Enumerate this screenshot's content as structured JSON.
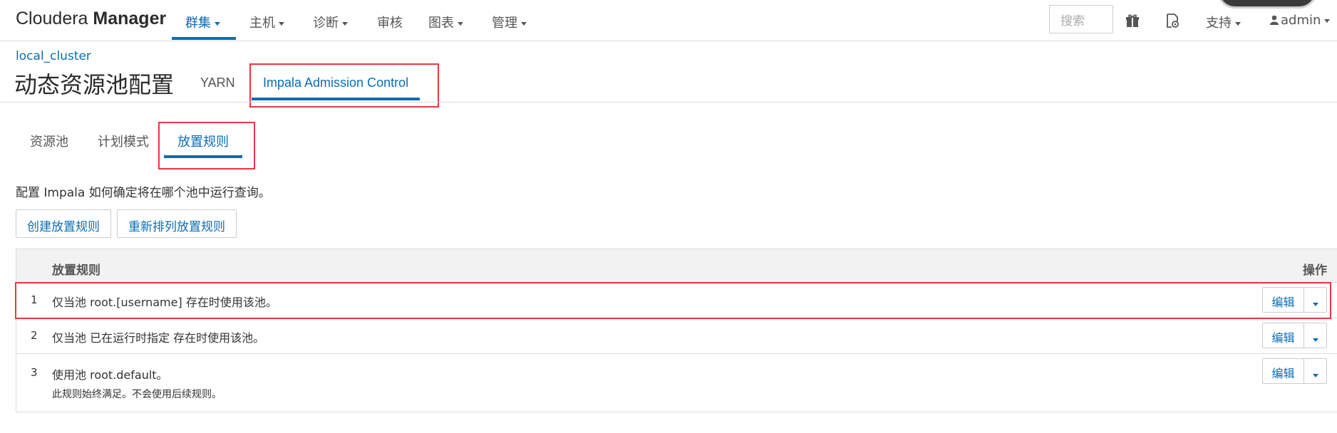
{
  "brand": {
    "part1": "Cloudera ",
    "part2": "Manager"
  },
  "nav": {
    "items": [
      {
        "label": "群集"
      },
      {
        "label": "主机"
      },
      {
        "label": "诊断"
      },
      {
        "label": "审核"
      },
      {
        "label": "图表"
      },
      {
        "label": "管理"
      }
    ],
    "active_index": 0,
    "search_placeholder": "搜索",
    "support_label": "支持",
    "user_label": "admin"
  },
  "breadcrumb": "local_cluster",
  "page_title": "动态资源池配置",
  "page_tabs": [
    {
      "label": "YARN"
    },
    {
      "label": "Impala Admission Control"
    }
  ],
  "sub_tabs": [
    {
      "label": "资源池"
    },
    {
      "label": "计划模式"
    },
    {
      "label": "放置规则"
    }
  ],
  "description": "配置 Impala 如何确定将在哪个池中运行查询。",
  "buttons": {
    "create": "创建放置规则",
    "reorder": "重新排列放置规则"
  },
  "table": {
    "col_rule": "放置规则",
    "col_ops": "操作",
    "rows": [
      {
        "num": "1",
        "text": "仅当池 root.[username] 存在时使用该池。",
        "note": "",
        "edit": "编辑"
      },
      {
        "num": "2",
        "text": "仅当池 已在运行时指定 存在时使用该池。",
        "note": "",
        "edit": "编辑"
      },
      {
        "num": "3",
        "text": "使用池 root.default。",
        "note": "此规则始终满足。不会使用后续规则。",
        "edit": "编辑"
      }
    ]
  },
  "colors": {
    "accent": "#0a6db5",
    "highlight": "#e8383d"
  }
}
